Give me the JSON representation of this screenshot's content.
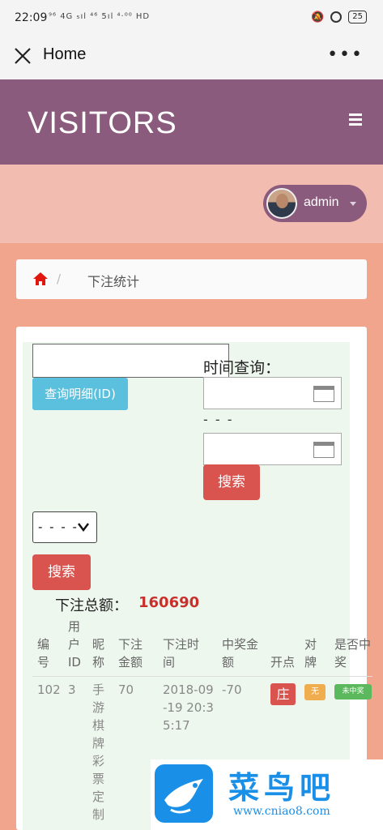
{
  "status_bar": {
    "time": "22:09",
    "signal": "⁹⁶ 4G ₅ıl ⁴⁶ 5ıl ⁴·⁰⁰ HD",
    "battery": "25"
  },
  "webview": {
    "title": "Home"
  },
  "app_nav": {
    "brand": "VISITORS"
  },
  "user": {
    "name": "admin"
  },
  "breadcrumb": {
    "separator": "/",
    "current": "下注统计"
  },
  "filters": {
    "detail_button": "查询明细(ID)",
    "time_label": "时间查询：",
    "range_separator": "- - -",
    "search_button": "搜索",
    "select_value": "- - - -",
    "search_button_2": "搜索"
  },
  "summary": {
    "label": "下注总额：",
    "value": "160690"
  },
  "table": {
    "headers": [
      "编号",
      "用户ID",
      "昵称",
      "下注金额",
      "下注时间",
      "中奖金额",
      "开点",
      "对牌",
      "是否中奖"
    ],
    "rows": [
      {
        "id": "102",
        "user_id": "3",
        "nickname": "手游棋牌彩票定制",
        "amount": "70",
        "time": "2018-09-19 20:35:17",
        "win_amount": "-70",
        "open_point": "庄",
        "pair": "无",
        "status": "未中奖"
      }
    ]
  },
  "watermark": {
    "title": "菜鸟吧",
    "url": "www.cniao8.com"
  },
  "colors": {
    "nav": "#8a5b7c",
    "user_bar": "#f3bcb0",
    "background": "#f1a58c",
    "danger": "#d9534f",
    "info": "#5bc0de",
    "success": "#5cb85c",
    "warning": "#f0ad4e"
  }
}
